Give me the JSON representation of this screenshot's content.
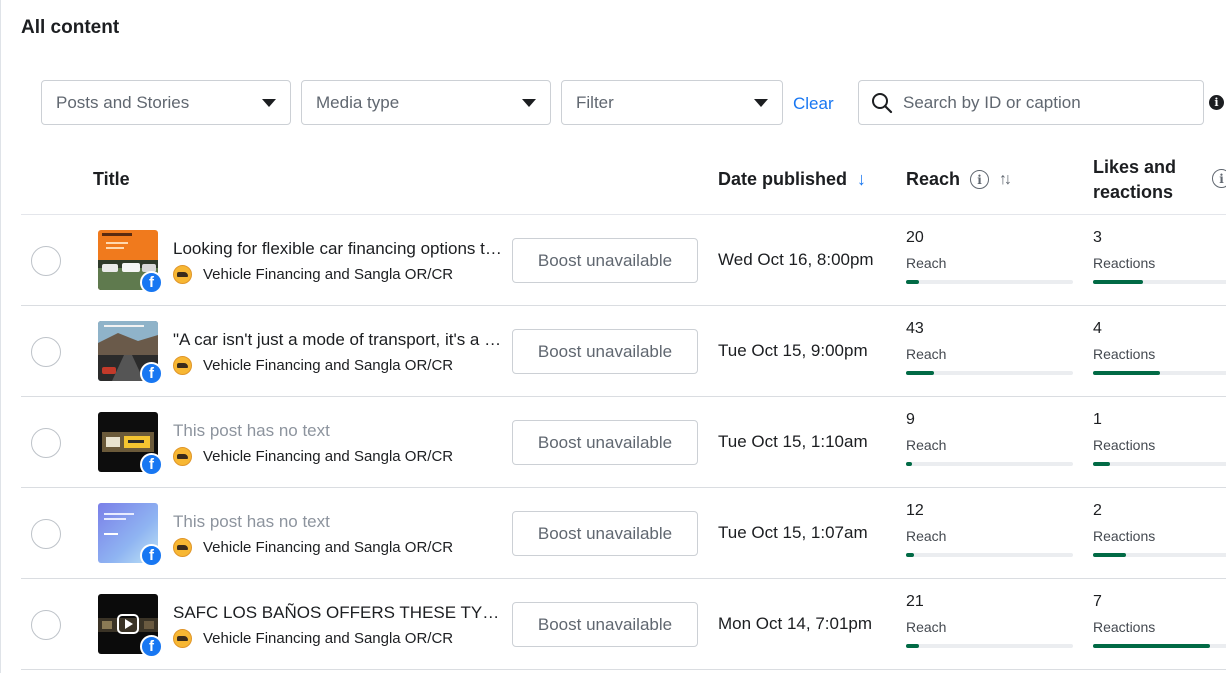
{
  "page_title": "All content",
  "filters": {
    "posts_stories": "Posts and Stories",
    "media_type": "Media type",
    "filter": "Filter",
    "clear": "Clear",
    "search_placeholder": "Search by ID or caption"
  },
  "columns": {
    "title": "Title",
    "date": "Date published",
    "reach": "Reach",
    "likes_line1": "Likes and",
    "likes_line2": "reactions"
  },
  "rows": [
    {
      "title": "Looking for flexible car financing options to get your dream car?",
      "title_muted": false,
      "page": "Vehicle Financing and Sangla OR/CR",
      "boost": "Boost unavailable",
      "date": "Wed Oct 16, 8:00pm",
      "reach": "20",
      "reach_label": "Reach",
      "reach_level": 0.08,
      "reactions": "3",
      "reactions_label": "Reactions",
      "reactions_level": 0.3,
      "thumb": "orange-promo"
    },
    {
      "title": "\"A car isn't just a mode of transport, it's a way of life.\"",
      "title_muted": false,
      "page": "Vehicle Financing and Sangla OR/CR",
      "boost": "Boost unavailable",
      "date": "Tue Oct 15, 9:00pm",
      "reach": "43",
      "reach_label": "Reach",
      "reach_level": 0.17,
      "reactions": "4",
      "reactions_label": "Reactions",
      "reactions_level": 0.4,
      "thumb": "road-landscape"
    },
    {
      "title": "This post has no text",
      "title_muted": true,
      "page": "Vehicle Financing and Sangla OR/CR",
      "boost": "Boost unavailable",
      "date": "Tue Oct 15, 1:10am",
      "reach": "9",
      "reach_label": "Reach",
      "reach_level": 0.035,
      "reactions": "1",
      "reactions_label": "Reactions",
      "reactions_level": 0.1,
      "thumb": "dark-banner"
    },
    {
      "title": "This post has no text",
      "title_muted": true,
      "page": "Vehicle Financing and Sangla OR/CR",
      "boost": "Boost unavailable",
      "date": "Tue Oct 15, 1:07am",
      "reach": "12",
      "reach_label": "Reach",
      "reach_level": 0.045,
      "reactions": "2",
      "reactions_label": "Reactions",
      "reactions_level": 0.2,
      "thumb": "blue-gradient"
    },
    {
      "title": "SAFC LOS BAÑOS OFFERS THESE TYPE OF LOANS",
      "title_muted": false,
      "page": "Vehicle Financing and Sangla OR/CR",
      "boost": "Boost unavailable",
      "date": "Mon Oct 14, 7:01pm",
      "reach": "21",
      "reach_label": "Reach",
      "reach_level": 0.08,
      "reactions": "7",
      "reactions_label": "Reactions",
      "reactions_level": 0.7,
      "thumb": "reel-video"
    }
  ]
}
